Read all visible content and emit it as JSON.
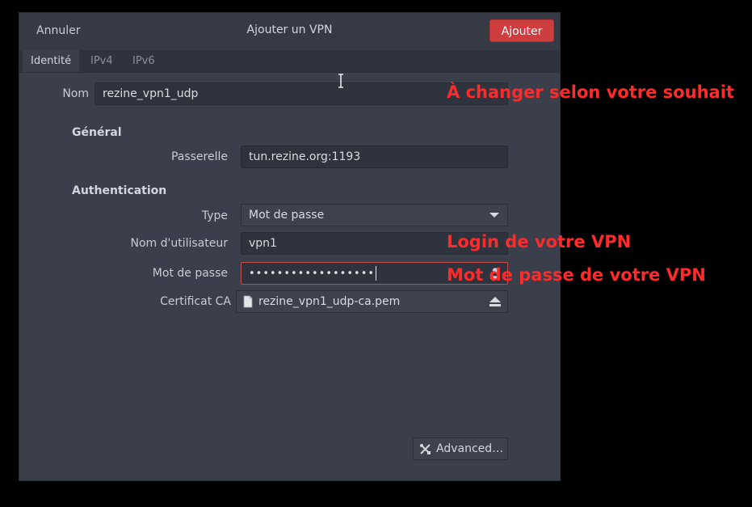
{
  "dialog": {
    "title": "Ajouter un VPN",
    "cancel_label": "Annuler",
    "add_label": "Ajouter"
  },
  "tabs": [
    {
      "label": "Identité",
      "active": true
    },
    {
      "label": "IPv4",
      "active": false
    },
    {
      "label": "IPv6",
      "active": false
    }
  ],
  "form": {
    "name_label": "Nom",
    "name_value": "rezine_vpn1_udp",
    "general_heading": "Général",
    "gateway_label": "Passerelle",
    "gateway_value": "tun.rezine.org:1193",
    "auth_heading": "Authentication",
    "type_label": "Type",
    "type_value": "Mot de passe",
    "username_label": "Nom d'utilisateur",
    "username_value": "vpn1",
    "password_label": "Mot de passe",
    "password_value": "••••••••••••••••••",
    "ca_label": "Certificat CA",
    "ca_value": "rezine_vpn1_udp-ca.pem",
    "advanced_label": "Advanced…"
  },
  "annotations": {
    "name_note": "À changer selon votre souhait",
    "login_note": "Login de votre VPN",
    "password_note": "Mot de passe de votre VPN",
    "color": "#ff2a2a"
  },
  "colors": {
    "accent": "#cf3e3e",
    "dialog_bg": "#3a3f4b",
    "field_bg": "#2f333d"
  }
}
